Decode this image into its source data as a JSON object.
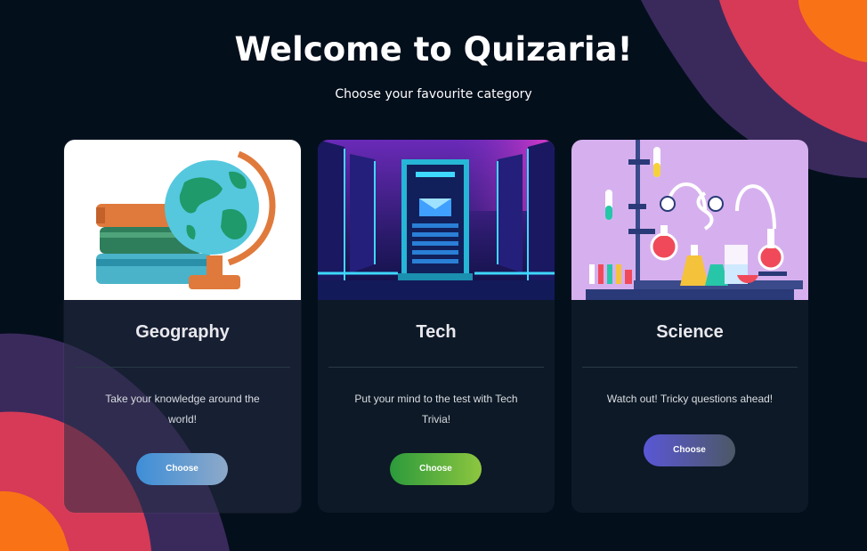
{
  "header": {
    "title": "Welcome to Quizaria!",
    "subtitle": "Choose your favourite category"
  },
  "cards": [
    {
      "title": "Geography",
      "description": "Take your knowledge around the world!",
      "button_label": "Choose",
      "image_icon": "globe-and-books-icon"
    },
    {
      "title": "Tech",
      "description": "Put your mind to the test with Tech Trivia!",
      "button_label": "Choose",
      "image_icon": "server-room-icon"
    },
    {
      "title": "Science",
      "description": "Watch out! Tricky questions ahead!",
      "button_label": "Choose",
      "image_icon": "chemistry-lab-icon"
    }
  ],
  "colors": {
    "background": "#040f1c",
    "blob_orange": "#f97316",
    "blob_red": "#d63a57",
    "blob_purple": "#3a2a5c",
    "geo_button": "#3d8ed8",
    "tech_button": "#2c9a3c",
    "science_button": "#5a57d6"
  }
}
